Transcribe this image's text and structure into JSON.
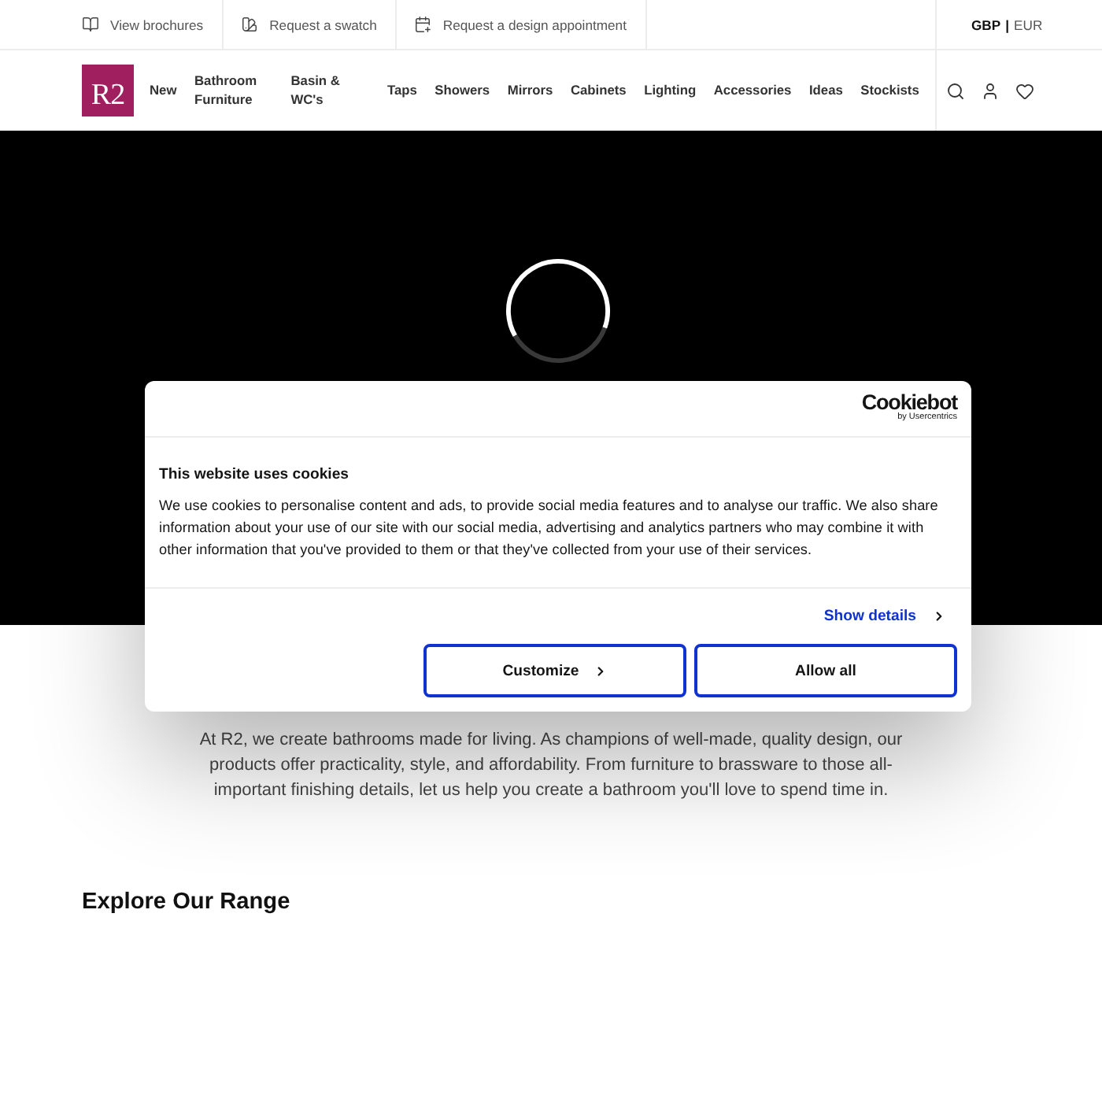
{
  "top_bar": {
    "links": [
      {
        "label": "View brochures"
      },
      {
        "label": "Request a swatch"
      },
      {
        "label": "Request a design appointment"
      }
    ],
    "currency": {
      "options": [
        {
          "label": "GBP",
          "selected": true
        },
        {
          "label": "EUR",
          "selected": false
        }
      ],
      "separator": "|"
    }
  },
  "header": {
    "logo": "R2",
    "nav": [
      "New",
      "Bathroom Furniture",
      "Basin & WC's",
      "Taps",
      "Showers",
      "Mirrors",
      "Cabinets",
      "Lighting",
      "Accessories",
      "Ideas",
      "Stockists"
    ]
  },
  "hero": {
    "loading": true
  },
  "cookie_dialog": {
    "brand": "Cookiebot",
    "brand_byline": "by Usercentrics",
    "title": "This website uses cookies",
    "text": "We use cookies to personalise content and ads, to provide social media features and to analyse our traffic. We also share information about your use of our site with our social media, advertising and analytics partners who may combine it with other information that you've provided to them or that they've collected from your use of their services.",
    "details_link": "Show details",
    "buttons": [
      {
        "label": "Customize",
        "kind": "expand"
      },
      {
        "label": "Allow all",
        "kind": "plain"
      }
    ]
  },
  "intro": {
    "text": "At R2, we create bathrooms made for living. As champions of well-made, quality design, our products offer practicality, style, and affordability. From furniture to brassware to those all-important finishing details, let us help you create a bathroom you'll love to spend time in."
  },
  "section": {
    "title": "Explore Our Range"
  }
}
